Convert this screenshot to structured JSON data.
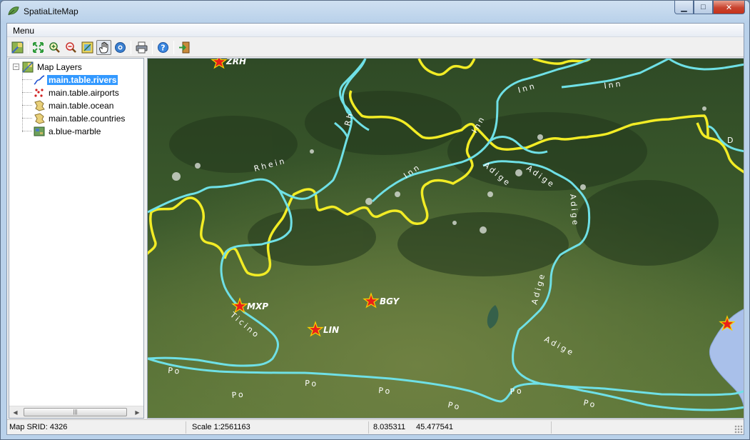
{
  "window": {
    "title": "SpatiaLiteMap",
    "minimize_glyph": "▁",
    "maximize_glyph": "□",
    "close_glyph": "✕"
  },
  "menubar": {
    "menu_label": "Menu"
  },
  "toolbar": {
    "buttons": [
      {
        "name": "map-layers-icon"
      },
      {
        "name": "zoom-full-icon"
      },
      {
        "name": "zoom-in-icon"
      },
      {
        "name": "zoom-out-icon"
      },
      {
        "name": "identify-icon"
      },
      {
        "name": "pan-hand-icon",
        "pressed": true
      },
      {
        "name": "info-icon"
      },
      {
        "name": "print-icon"
      },
      {
        "name": "help-icon"
      },
      {
        "name": "exit-icon"
      }
    ]
  },
  "tree": {
    "root_label": "Map Layers",
    "expander_glyph": "−",
    "layers": [
      {
        "label": "main.table.rivers",
        "icon": "river-line-icon",
        "selected": true
      },
      {
        "label": "main.table.airports",
        "icon": "airport-points-icon",
        "selected": false
      },
      {
        "label": "main.table.ocean",
        "icon": "polygon-layer-icon",
        "selected": false
      },
      {
        "label": "main.table.countries",
        "icon": "polygon-layer-icon",
        "selected": false
      },
      {
        "label": "a.blue-marble",
        "icon": "raster-layer-icon",
        "selected": false
      }
    ],
    "scroll_left_glyph": "◀",
    "scroll_right_glyph": "▶",
    "scroll_thumb_glyph": "|||"
  },
  "map": {
    "colors": {
      "river": "#6fe0e6",
      "border": "#f2ec25",
      "airport": "#e8201a",
      "airport_edge": "#f7d000",
      "lake": "#a9c0ea"
    },
    "airports": [
      {
        "code": "ZRH"
      },
      {
        "code": "MXP"
      },
      {
        "code": "BGY"
      },
      {
        "code": "LIN"
      }
    ],
    "river_labels": [
      "Rhein",
      "Rh",
      "Inn",
      "Inn",
      "Inn",
      "Inn",
      "Adige",
      "Adige",
      "Adige",
      "Adige",
      "Adige",
      "Ticino",
      "Po",
      "Po",
      "Po",
      "Po",
      "Po",
      "Po",
      "Po",
      "D"
    ]
  },
  "status": {
    "srid": "Map SRID: 4326",
    "scale": "Scale 1:2561163",
    "x": "8.035311",
    "y": "45.477541"
  }
}
